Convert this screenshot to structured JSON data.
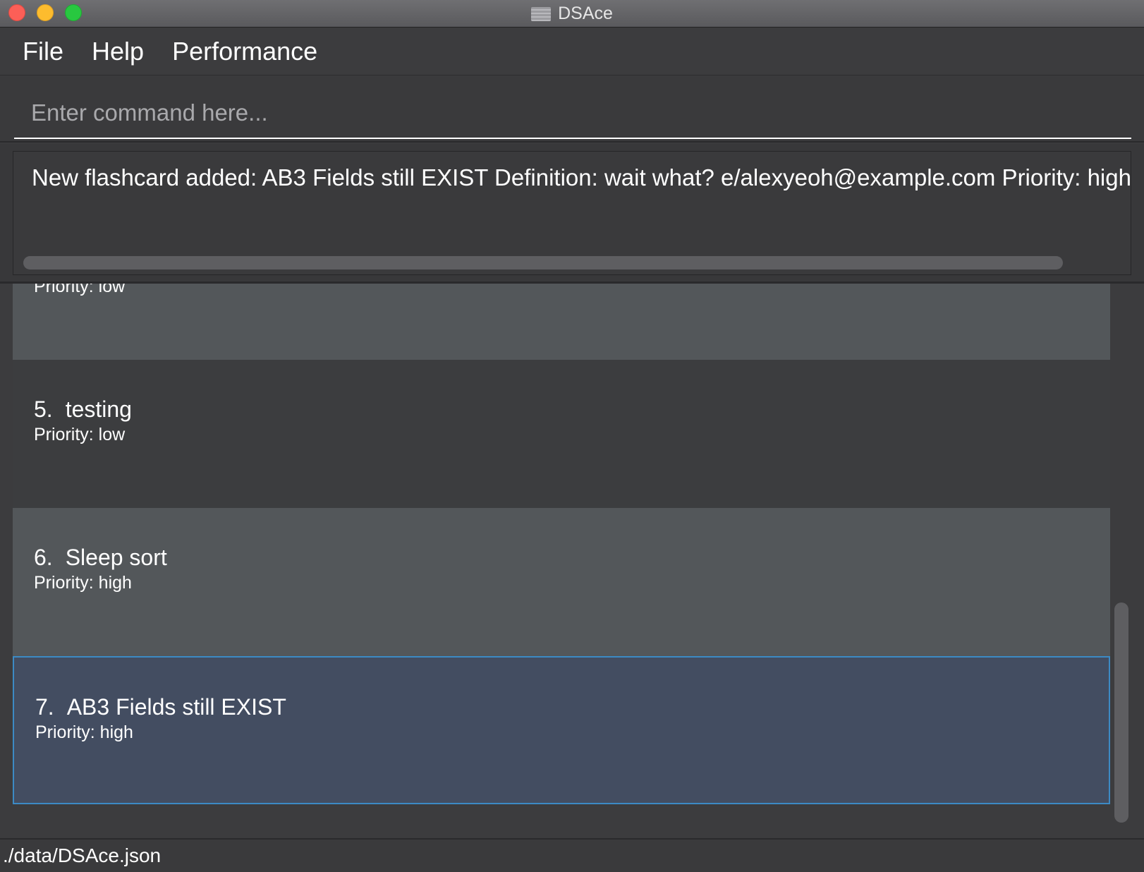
{
  "window": {
    "title": "DSAce"
  },
  "menu": {
    "items": [
      "File",
      "Help",
      "Performance"
    ]
  },
  "command": {
    "placeholder": "Enter command here...",
    "value": ""
  },
  "result": {
    "text": "New flashcard added: AB3 Fields still EXIST Definition: wait what? e/alexyeoh@example.com Priority: high T"
  },
  "flashcards": [
    {
      "index": "",
      "title": "",
      "priority": "Priority: low"
    },
    {
      "index": "5.",
      "title": "testing",
      "priority": "Priority: low"
    },
    {
      "index": "6.",
      "title": "Sleep sort",
      "priority": "Priority: high"
    },
    {
      "index": "7.",
      "title": "AB3 Fields still EXIST",
      "priority": "Priority: high",
      "selected": true
    }
  ],
  "status": {
    "path": "./data/DSAce.json"
  },
  "colors": {
    "background": "#3a3a3c",
    "card_odd": "#53575a",
    "card_even": "#3c3d3f",
    "card_selected": "#434d61",
    "selection_border": "#3c8ac4"
  },
  "icons": [
    "close-window-icon",
    "minimize-window-icon",
    "zoom-window-icon",
    "app-icon"
  ]
}
